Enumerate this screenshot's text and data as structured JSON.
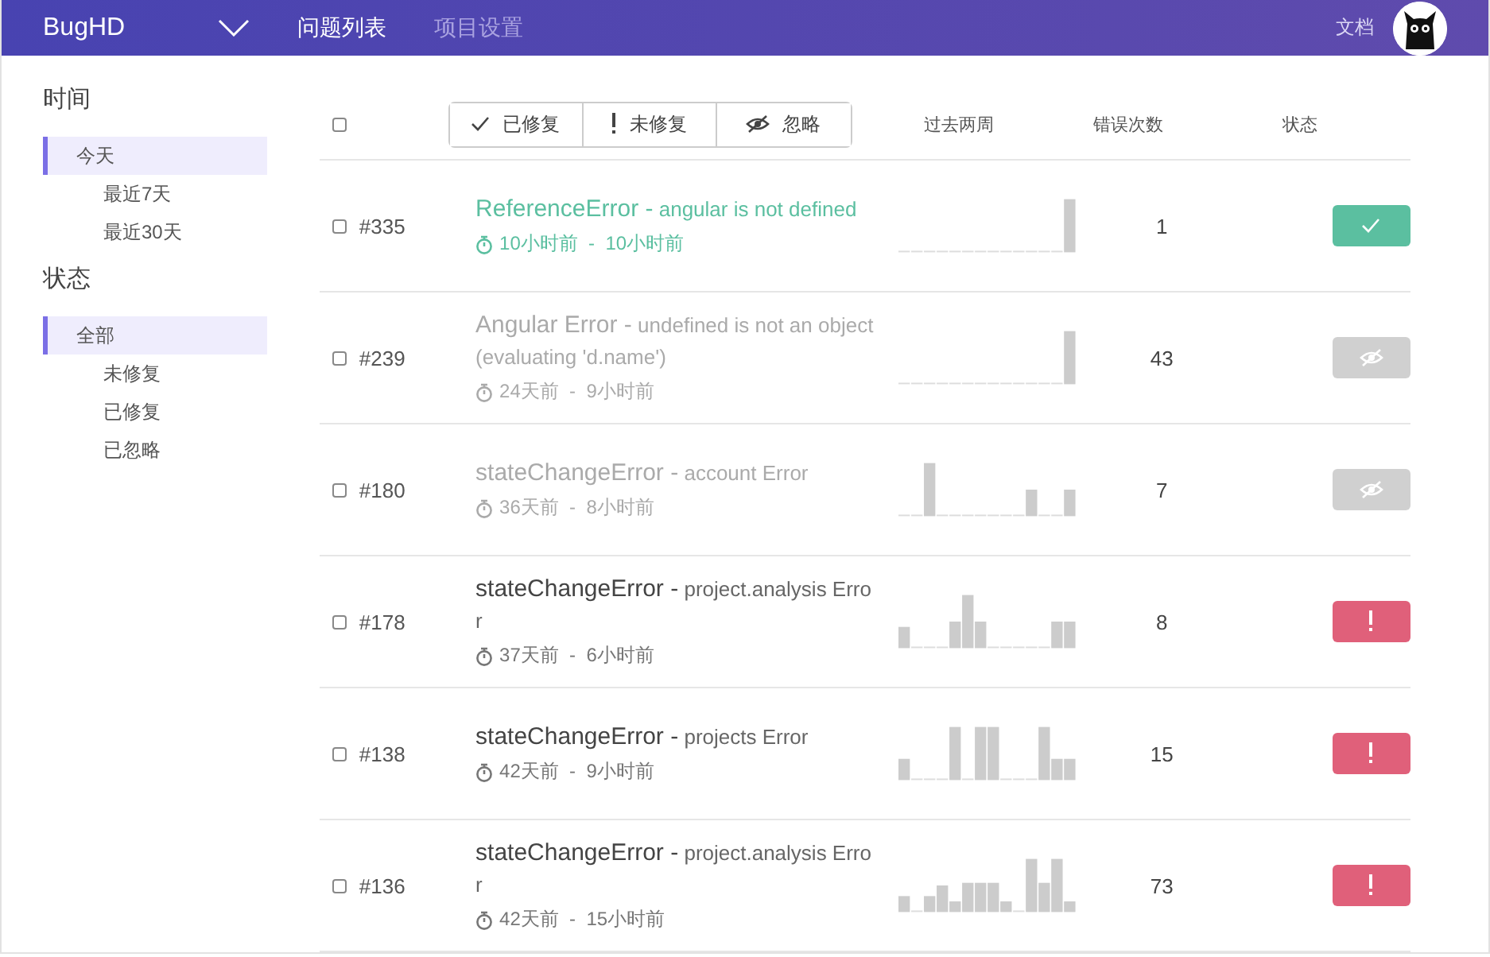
{
  "header": {
    "logo": "BugHD",
    "nav": [
      {
        "label": "问题列表",
        "selected": true
      },
      {
        "label": "项目设置",
        "selected": false
      }
    ],
    "docs_link": "文档"
  },
  "sidebar": {
    "sections": [
      {
        "title": "时间",
        "items": [
          {
            "label": "今天",
            "selected": true
          },
          {
            "label": "最近7天",
            "selected": false
          },
          {
            "label": "最近30天",
            "selected": false
          }
        ]
      },
      {
        "title": "状态",
        "items": [
          {
            "label": "全部",
            "selected": true
          },
          {
            "label": "未修复",
            "selected": false
          },
          {
            "label": "已修复",
            "selected": false
          },
          {
            "label": "已忽略",
            "selected": false
          }
        ]
      }
    ]
  },
  "toolbar": {
    "select_all": {
      "checked": false
    },
    "actions": [
      {
        "kind": "fixed",
        "label": "已修复"
      },
      {
        "kind": "unfixed",
        "label": "未修复"
      },
      {
        "kind": "ignored",
        "label": "忽略"
      }
    ],
    "columns": [
      "过去两周",
      "错误次数",
      "状态"
    ]
  },
  "issues": [
    {
      "id": "#335",
      "checked": false,
      "kind": "fixed",
      "title": "ReferenceError -",
      "message": "angular is not defined",
      "time": "10小时前  -  10小时前",
      "count": "1"
    },
    {
      "id": "#239",
      "checked": false,
      "kind": "ignored",
      "title": "Angular Error -",
      "message": "undefined is not an object (evaluating 'd.name')",
      "time": "24天前  -  9小时前",
      "count": "43"
    },
    {
      "id": "#180",
      "checked": false,
      "kind": "ignored",
      "title": "stateChangeError -",
      "message": "account Error",
      "time": "36天前  -  8小时前",
      "count": "7"
    },
    {
      "id": "#178",
      "checked": false,
      "kind": "unfixed",
      "title": "stateChangeError -",
      "message": "project.analysis Error",
      "time": "37天前  -  6小时前",
      "count": "8"
    },
    {
      "id": "#138",
      "checked": false,
      "kind": "unfixed",
      "title": "stateChangeError -",
      "message": "projects Error",
      "time": "42天前  -  9小时前",
      "count": "15"
    },
    {
      "id": "#136",
      "checked": false,
      "kind": "unfixed",
      "title": "stateChangeError -",
      "message": "project.analysis Error",
      "time": "42天前  -  15小时前",
      "count": "73"
    }
  ]
}
